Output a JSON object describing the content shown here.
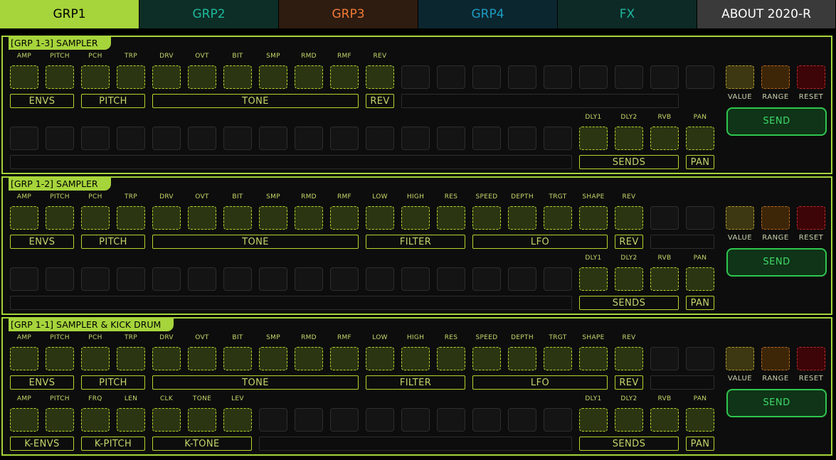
{
  "tabs": [
    {
      "label": "GRP1",
      "bg": "#a6d43b",
      "fg": "#000000"
    },
    {
      "label": "GRP2",
      "bg": "#0d2e26",
      "fg": "#1fb89c"
    },
    {
      "label": "GRP3",
      "bg": "#2e1c10",
      "fg": "#f07a36"
    },
    {
      "label": "GRP4",
      "bg": "#0c2630",
      "fg": "#1d9cc2"
    },
    {
      "label": "FX",
      "bg": "#0d2a26",
      "fg": "#1eb8a0"
    },
    {
      "label": "ABOUT 2020-R",
      "bg": "#3a3a3a",
      "fg": "#ffffff"
    }
  ],
  "panels": [
    {
      "title": "[GRP 1-3] SAMPLER",
      "row1": [
        "AMP",
        "PITCH",
        "PCH",
        "TRP",
        "DRV",
        "OVT",
        "BIT",
        "SMP",
        "RMD",
        "RMF",
        "REV",
        "",
        "",
        "",
        "",
        "",
        "",
        "",
        ""
      ],
      "row1_groups": [
        {
          "label": "ENVS",
          "span": [
            0,
            1
          ]
        },
        {
          "label": "PITCH",
          "span": [
            2,
            3
          ]
        },
        {
          "label": "TONE",
          "span": [
            4,
            9
          ]
        },
        {
          "label": "REV",
          "span": [
            10,
            10
          ]
        },
        {
          "label": "",
          "span": [
            11,
            18
          ]
        }
      ],
      "row2": [
        "",
        "",
        "",
        "",
        "",
        "",
        "",
        "",
        "",
        "",
        "",
        "",
        "",
        "",
        "",
        "",
        "DLY1",
        "DLY2",
        "RVB",
        "PAN"
      ],
      "row2_groups": [
        {
          "label": "",
          "span": [
            0,
            15
          ]
        },
        {
          "label": "SENDS",
          "span": [
            16,
            18
          ]
        },
        {
          "label": "PAN",
          "span": [
            19,
            19
          ]
        }
      ]
    },
    {
      "title": "[GRP 1-2] SAMPLER",
      "row1": [
        "AMP",
        "PITCH",
        "PCH",
        "TRP",
        "DRV",
        "OVT",
        "BIT",
        "SMP",
        "RMD",
        "RMF",
        "LOW",
        "HIGH",
        "RES",
        "SPEED",
        "DEPTH",
        "TRGT",
        "SHAPE",
        "REV",
        "",
        ""
      ],
      "row1_groups": [
        {
          "label": "ENVS",
          "span": [
            0,
            1
          ]
        },
        {
          "label": "PITCH",
          "span": [
            2,
            3
          ]
        },
        {
          "label": "TONE",
          "span": [
            4,
            9
          ]
        },
        {
          "label": "FILTER",
          "span": [
            10,
            12
          ]
        },
        {
          "label": "LFO",
          "span": [
            13,
            16
          ]
        },
        {
          "label": "REV",
          "span": [
            17,
            17
          ]
        },
        {
          "label": "",
          "span": [
            18,
            19
          ]
        }
      ],
      "row2": [
        "",
        "",
        "",
        "",
        "",
        "",
        "",
        "",
        "",
        "",
        "",
        "",
        "",
        "",
        "",
        "",
        "DLY1",
        "DLY2",
        "RVB",
        "PAN"
      ],
      "row2_groups": [
        {
          "label": "",
          "span": [
            0,
            15
          ]
        },
        {
          "label": "SENDS",
          "span": [
            16,
            18
          ]
        },
        {
          "label": "PAN",
          "span": [
            19,
            19
          ]
        }
      ]
    },
    {
      "title": "[GRP 1-1] SAMPLER & KICK DRUM",
      "row1": [
        "AMP",
        "PITCH",
        "PCH",
        "TRP",
        "DRV",
        "OVT",
        "BIT",
        "SMP",
        "RMD",
        "RMF",
        "LOW",
        "HIGH",
        "RES",
        "SPEED",
        "DEPTH",
        "TRGT",
        "SHAPE",
        "REV",
        "",
        ""
      ],
      "row1_groups": [
        {
          "label": "ENVS",
          "span": [
            0,
            1
          ]
        },
        {
          "label": "PITCH",
          "span": [
            2,
            3
          ]
        },
        {
          "label": "TONE",
          "span": [
            4,
            9
          ]
        },
        {
          "label": "FILTER",
          "span": [
            10,
            12
          ]
        },
        {
          "label": "LFO",
          "span": [
            13,
            16
          ]
        },
        {
          "label": "REV",
          "span": [
            17,
            17
          ]
        },
        {
          "label": "",
          "span": [
            18,
            19
          ]
        }
      ],
      "row2": [
        "AMP",
        "PITCH",
        "FRQ",
        "LEN",
        "CLK",
        "TONE",
        "LEV",
        "",
        "",
        "",
        "",
        "",
        "",
        "",
        "",
        "",
        "DLY1",
        "DLY2",
        "RVB",
        "PAN"
      ],
      "row2_groups": [
        {
          "label": "K-ENVS",
          "span": [
            0,
            1
          ]
        },
        {
          "label": "K-PITCH",
          "span": [
            2,
            3
          ]
        },
        {
          "label": "K-TONE",
          "span": [
            4,
            6
          ]
        },
        {
          "label": "",
          "span": [
            7,
            15
          ]
        },
        {
          "label": "SENDS",
          "span": [
            16,
            18
          ]
        },
        {
          "label": "PAN",
          "span": [
            19,
            19
          ]
        }
      ]
    }
  ],
  "controls": {
    "value": "VALUE",
    "range": "RANGE",
    "reset": "RESET",
    "send": "SEND"
  }
}
